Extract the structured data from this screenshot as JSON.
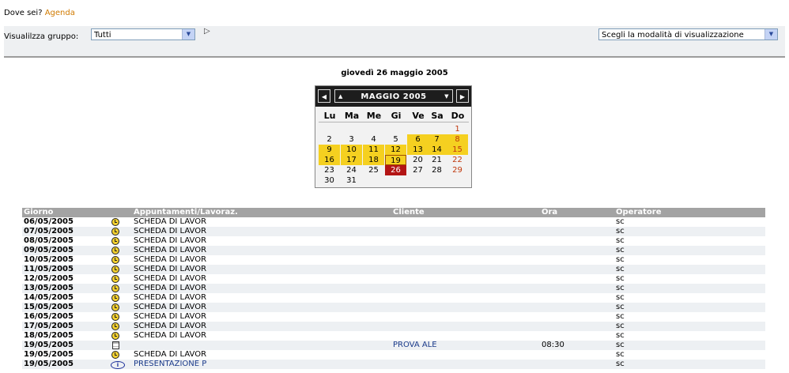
{
  "breadcrumb": {
    "label": "Dove sei?",
    "current": "Agenda"
  },
  "toolbar": {
    "group_label": "Visualilzza gruppo:",
    "group_value": "Tutti",
    "mode_value": "Scegli la modalità di visualizzazione"
  },
  "date_heading": "giovedì 26 maggio 2005",
  "calendar": {
    "month_label": "MAGGIO 2005",
    "weekdays": [
      "Lu",
      "Ma",
      "Me",
      "Gi",
      "Ve",
      "Sa",
      "Do"
    ],
    "first_weekday_index": 6,
    "days_in_month": 31,
    "highlighted_days": [
      6,
      7,
      8,
      9,
      10,
      11,
      12,
      13,
      14,
      15,
      16,
      17,
      18,
      19
    ],
    "red_days": [
      1,
      8,
      15,
      22,
      29
    ],
    "today": 26,
    "selected_day": 19,
    "colors": {
      "highlight": "#f5d020",
      "today": "#b31515",
      "holiday_text": "#c0380c",
      "header_bg": "#1d1d1d"
    }
  },
  "table": {
    "headers": {
      "day": "Giorno",
      "appointment": "Appuntamenti/Lavoraz.",
      "client": "Cliente",
      "time": "Ora",
      "operator": "Operatore"
    },
    "rows": [
      {
        "day": "06/05/2005",
        "icon": "clock-icon",
        "appointment": "SCHEDA DI LAVOR",
        "client": "",
        "time": "",
        "operator": "sc"
      },
      {
        "day": "07/05/2005",
        "icon": "clock-icon",
        "appointment": "SCHEDA DI LAVOR",
        "client": "",
        "time": "",
        "operator": "sc"
      },
      {
        "day": "08/05/2005",
        "icon": "clock-icon",
        "appointment": "SCHEDA DI LAVOR",
        "client": "",
        "time": "",
        "operator": "sc"
      },
      {
        "day": "09/05/2005",
        "icon": "clock-icon",
        "appointment": "SCHEDA DI LAVOR",
        "client": "",
        "time": "",
        "operator": "sc"
      },
      {
        "day": "10/05/2005",
        "icon": "clock-icon",
        "appointment": "SCHEDA DI LAVOR",
        "client": "",
        "time": "",
        "operator": "sc"
      },
      {
        "day": "11/05/2005",
        "icon": "clock-icon",
        "appointment": "SCHEDA DI LAVOR",
        "client": "",
        "time": "",
        "operator": "sc"
      },
      {
        "day": "12/05/2005",
        "icon": "clock-icon",
        "appointment": "SCHEDA DI LAVOR",
        "client": "",
        "time": "",
        "operator": "sc"
      },
      {
        "day": "13/05/2005",
        "icon": "clock-icon",
        "appointment": "SCHEDA DI LAVOR",
        "client": "",
        "time": "",
        "operator": "sc"
      },
      {
        "day": "14/05/2005",
        "icon": "clock-icon",
        "appointment": "SCHEDA DI LAVOR",
        "client": "",
        "time": "",
        "operator": "sc"
      },
      {
        "day": "15/05/2005",
        "icon": "clock-icon",
        "appointment": "SCHEDA DI LAVOR",
        "client": "",
        "time": "",
        "operator": "sc"
      },
      {
        "day": "16/05/2005",
        "icon": "clock-icon",
        "appointment": "SCHEDA DI LAVOR",
        "client": "",
        "time": "",
        "operator": "sc"
      },
      {
        "day": "17/05/2005",
        "icon": "clock-icon",
        "appointment": "SCHEDA DI LAVOR",
        "client": "",
        "time": "",
        "operator": "sc"
      },
      {
        "day": "18/05/2005",
        "icon": "clock-icon",
        "appointment": "SCHEDA DI LAVOR",
        "client": "",
        "time": "",
        "operator": "sc"
      },
      {
        "day": "19/05/2005",
        "icon": "note-icon",
        "appointment": "",
        "client": "PROVA ALE",
        "time": "08:30",
        "operator": "sc"
      },
      {
        "day": "19/05/2005",
        "icon": "clock-icon",
        "appointment": "SCHEDA DI LAVOR",
        "client": "",
        "time": "",
        "operator": "sc"
      },
      {
        "day": "19/05/2005",
        "icon": "info-icon",
        "appointment": "PRESENTAZIONE P",
        "client": "",
        "time": "",
        "operator": "sc"
      }
    ]
  }
}
